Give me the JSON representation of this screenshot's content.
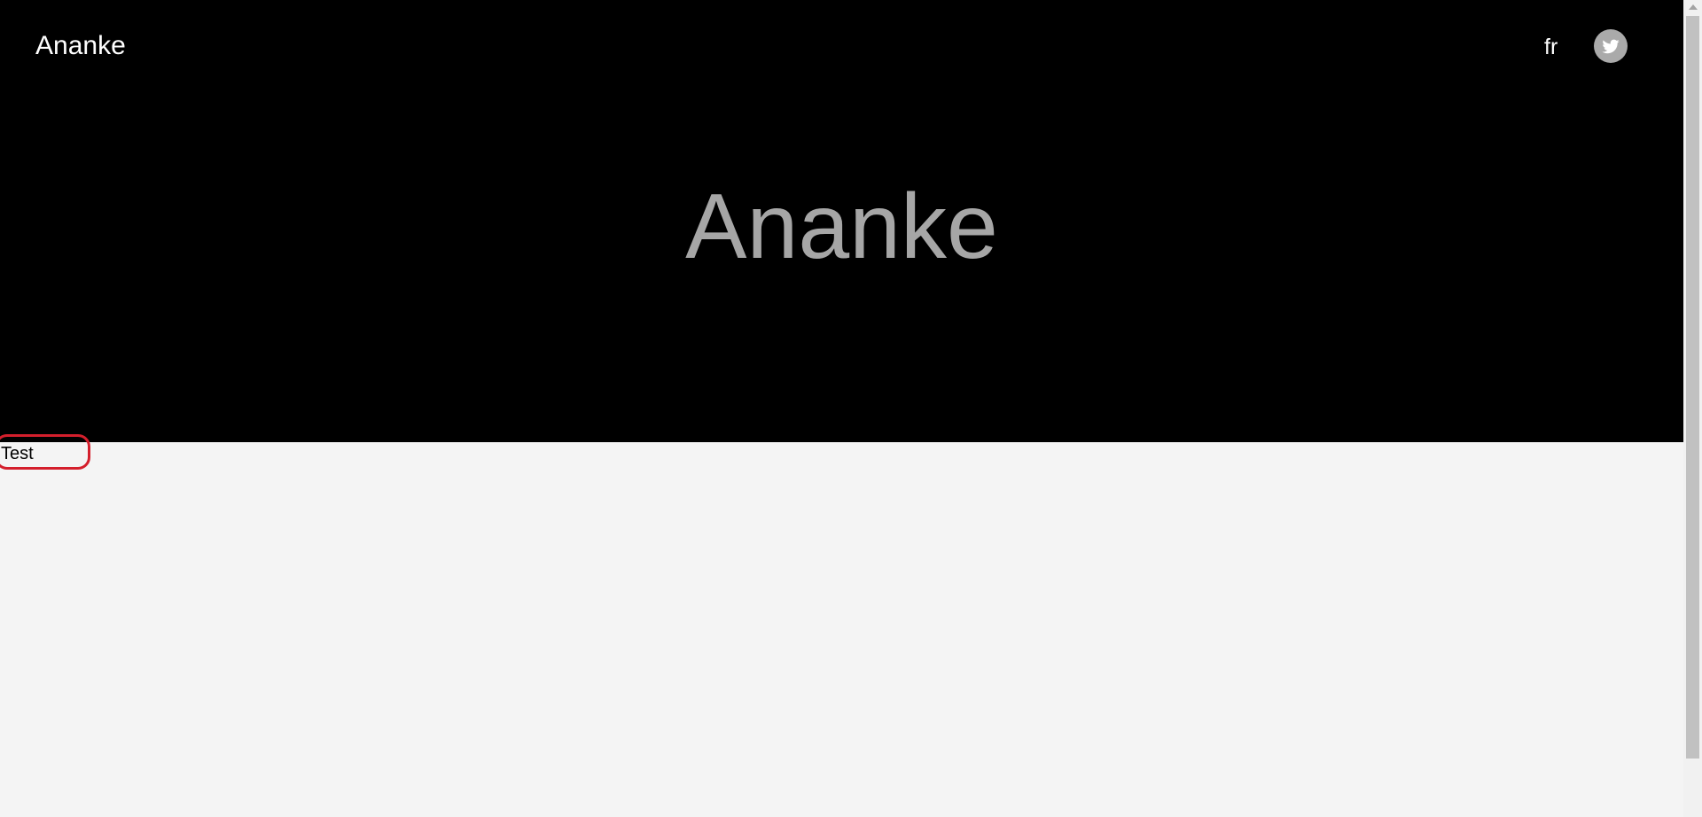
{
  "header": {
    "brand": "Ananke",
    "lang_link": "fr",
    "twitter_icon": "twitter-icon"
  },
  "hero": {
    "title": "Ananke"
  },
  "content": {
    "text": "Test"
  },
  "colors": {
    "hero_background": "#000000",
    "page_background": "#f4f4f4",
    "hero_title": "#a6a6a6",
    "annotation": "#d41f2c"
  }
}
